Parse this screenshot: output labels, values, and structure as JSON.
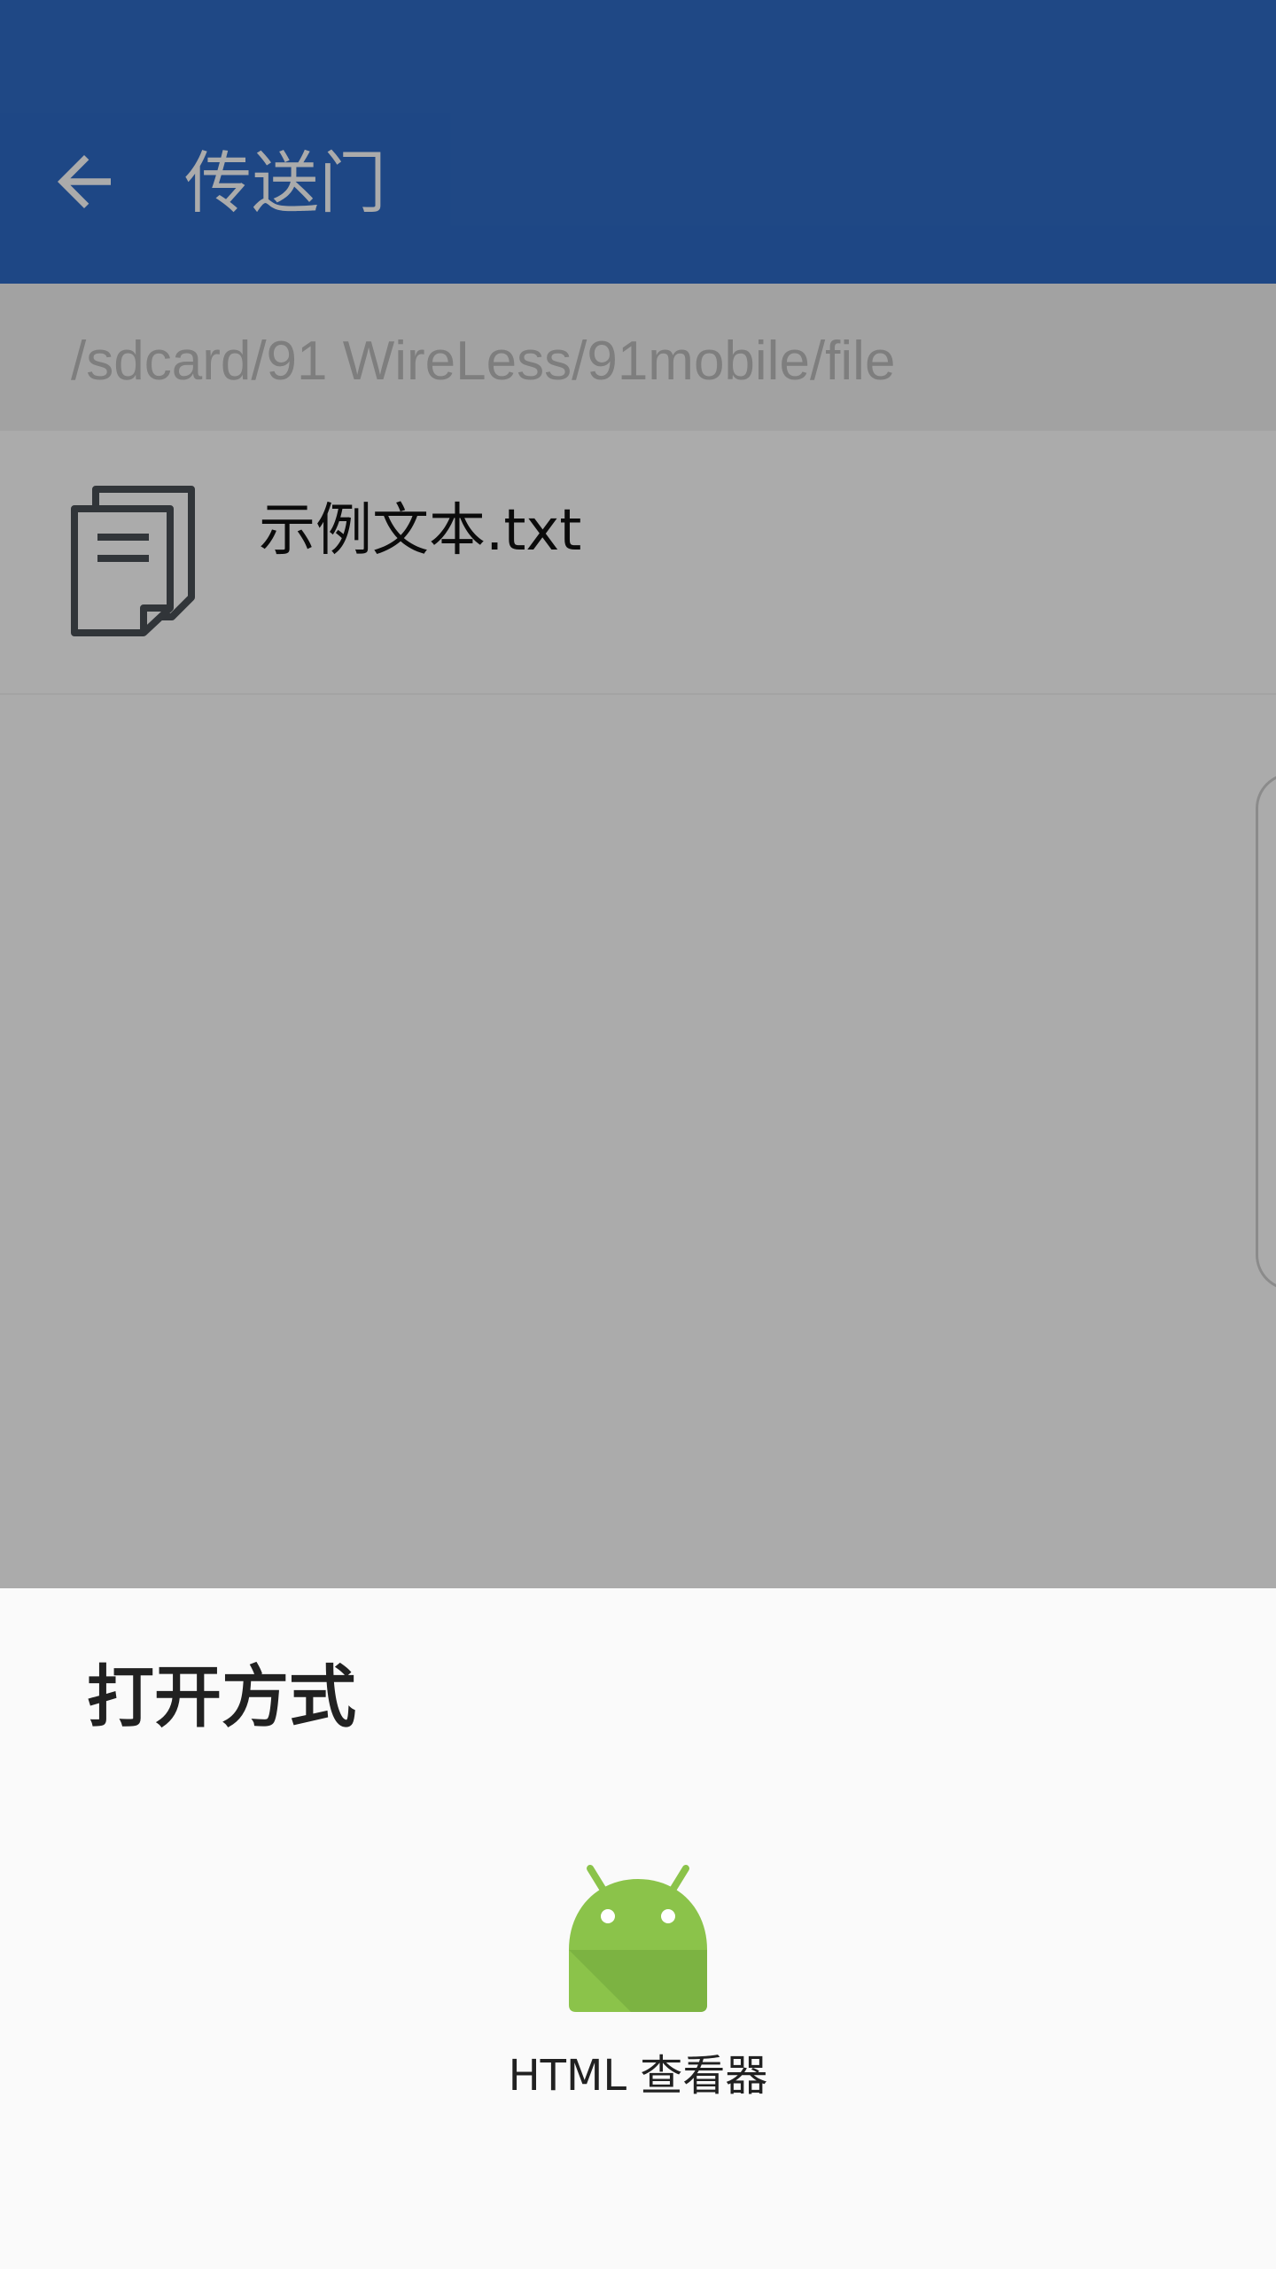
{
  "app_bar": {
    "back_icon": "arrow-back-icon",
    "title": "传送门"
  },
  "path_bar": {
    "path": "/sdcard/91 WireLess/91mobile/file"
  },
  "files": [
    {
      "icon": "document-icon",
      "name": "示例文本.txt"
    }
  ],
  "open_with_sheet": {
    "title": "打开方式",
    "apps": [
      {
        "icon": "android-icon",
        "label": "HTML 查看器"
      }
    ]
  },
  "colors": {
    "app_bar": "#2e6bc6",
    "android_green": "#8bc34a"
  }
}
